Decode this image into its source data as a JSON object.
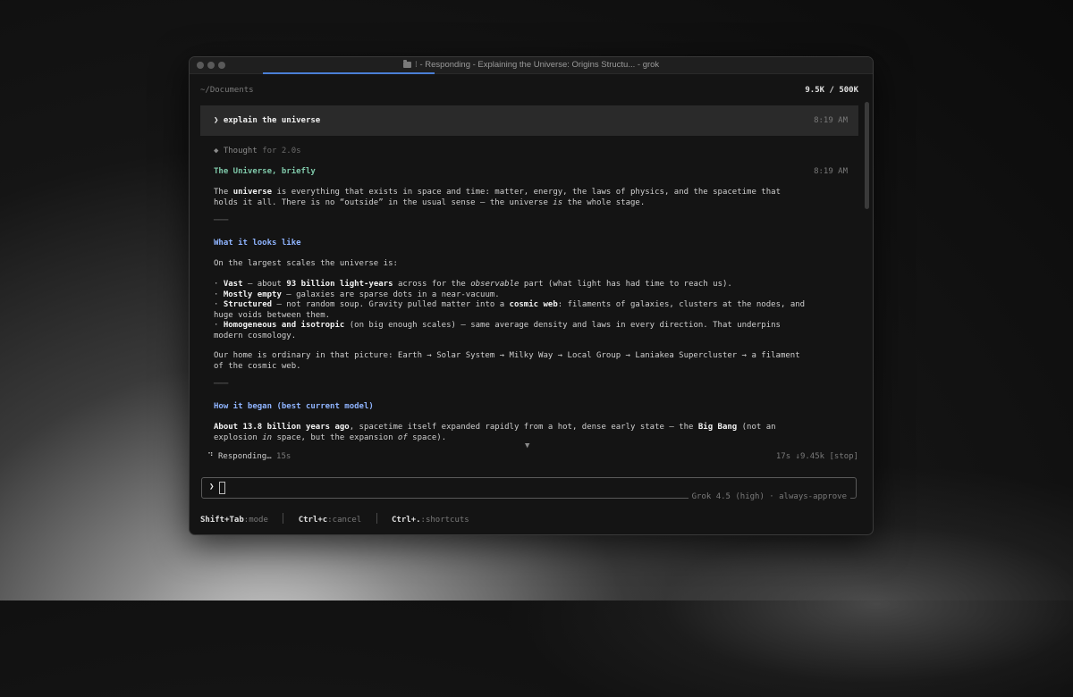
{
  "window": {
    "title": "⁝ - Responding - Explaining the Universe: Origins Structu... - grok"
  },
  "header": {
    "path": "~/Documents",
    "tokens": "9.5K / 500K"
  },
  "prompt": {
    "text": "❯ explain the universe",
    "time": "8:19 AM"
  },
  "thought": {
    "label": "◆ Thought",
    "duration": "for 2.0s"
  },
  "response": {
    "title": "The Universe, briefly",
    "time": "8:19 AM",
    "p1_line1_pre": "The ",
    "p1_line1_bold": "universe",
    "p1_line1_post": " is everything that exists in space and time: matter, energy, the laws of physics, and the spacetime that",
    "p1_line2_a": "holds it all. There is no “outside” in the usual sense — the universe ",
    "p1_line2_em": "is",
    "p1_line2_b": " the whole stage.",
    "separator": "───",
    "h1": "What it looks like",
    "p2": "On the largest scales the universe is:",
    "b1_a": "· ",
    "b1_bold1": "Vast",
    "b1_mid": " — about ",
    "b1_bold2": "93 billion light-years",
    "b1_mid2": " across for the ",
    "b1_em": "observable",
    "b1_end": " part (what light has had time to reach us).",
    "b2_a": "· ",
    "b2_bold": "Mostly empty",
    "b2_end": " — galaxies are sparse dots in a near-vacuum.",
    "b3_a": "· ",
    "b3_bold1": "Structured",
    "b3_mid": " — not random soup. Gravity pulled matter into a ",
    "b3_bold2": "cosmic web",
    "b3_end": ": filaments of galaxies, clusters at the nodes, and",
    "b3_line2": "huge voids between them.",
    "b4_a": "· ",
    "b4_bold": "Homogeneous and isotropic",
    "b4_end": " (on big enough scales) — same average density and laws in every direction. That underpins",
    "b4_line2": "modern cosmology.",
    "p3_line1": "Our home is ordinary in that picture: Earth → Solar System → Milky Way → Local Group → Laniakea Supercluster → a filament",
    "p3_line2": "of the cosmic web.",
    "h2": "How it began (best current model)",
    "p4_bold": "About 13.8 billion years ago",
    "p4_mid": ", spacetime itself expanded rapidly from a hot, dense early state — the ",
    "p4_bold2": "Big Bang",
    "p4_end": " (not an",
    "p4_line2_a": "explosion ",
    "p4_line2_em1": "in",
    "p4_line2_b": " space, but the expansion ",
    "p4_line2_em2": "of",
    "p4_line2_c": " space)."
  },
  "status": {
    "spinner": "⠙",
    "label": "Responding…",
    "elapsed": "15s",
    "right": "17s ↓9.45k [stop]",
    "scroll_arrow": "▼"
  },
  "input": {
    "caret": "❯",
    "model": "Grok 4.5 (high) · always-approve"
  },
  "footer": {
    "k1": "Shift+Tab",
    "a1": ":mode",
    "k2": "Ctrl+c",
    "a2": ":cancel",
    "k3": "Ctrl+.",
    "a3": ":shortcuts"
  },
  "colors": {
    "accent_blue": "#4a7fd6",
    "heading_blue": "#8fb4ff",
    "title_green": "#7fc8a9"
  }
}
